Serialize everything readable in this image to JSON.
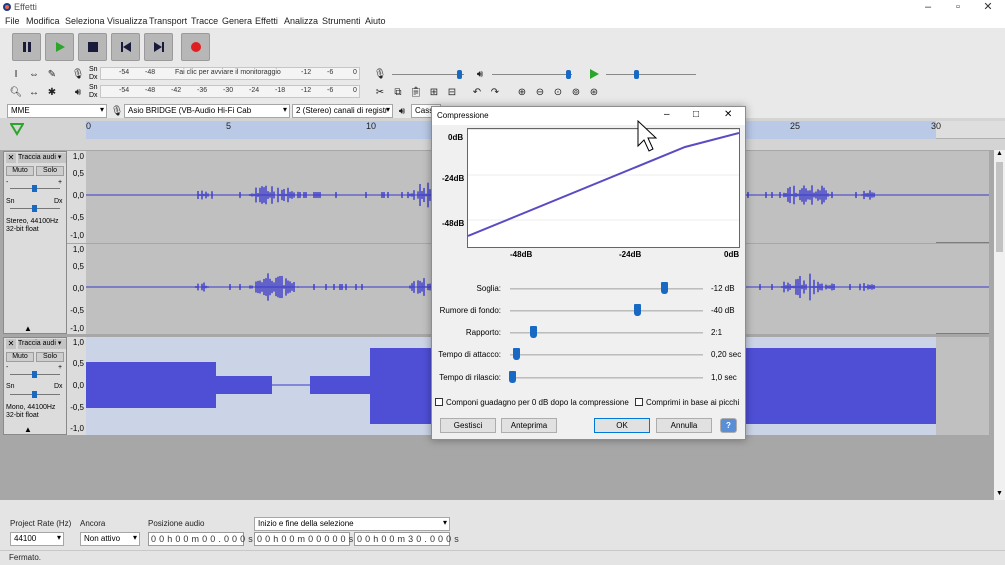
{
  "window": {
    "title": "Effetti"
  },
  "menu": [
    "File",
    "Modifica",
    "Seleziona",
    "Visualizza",
    "Transport",
    "Tracce",
    "Genera",
    "Effetti",
    "Analizza",
    "Strumenti",
    "Aiuto"
  ],
  "meters": {
    "rec_channels": [
      "Sn",
      "Dx"
    ],
    "rec_scale_a": "-54",
    "rec_scale_b": "-48",
    "rec_prompt": "Fai clic per avviare il monitoraggio",
    "rec_scale_c": "-12",
    "rec_scale_d": "-6",
    "rec_scale_e": "0",
    "play_channels": [
      "Sn",
      "Dx"
    ],
    "play_scale": [
      "-54",
      "-48",
      "-42",
      "-36",
      "-30",
      "-24",
      "-18",
      "-12",
      "-6",
      "0"
    ]
  },
  "device": {
    "host": "MME",
    "input": "Asio BRIDGE (VB-Audio Hi-Fi Cab",
    "channels": "2 (Stereo) canali di registr",
    "output": "Cass"
  },
  "ruler": {
    "ticks": [
      "0",
      "5",
      "10",
      "25",
      "30"
    ]
  },
  "tracks": [
    {
      "name": "Traccia audi",
      "mute": "Muto",
      "solo": "Solo",
      "pan_left": "Sn",
      "pan_right": "Dx",
      "gain_minus": "-",
      "gain_plus": "+",
      "info1": "Stereo, 44100Hz",
      "info2": "32-bit float",
      "scale_ch1": [
        "1,0",
        "0,5",
        "0,0",
        "-0,5",
        "-1,0"
      ],
      "scale_ch2": [
        "1,0",
        "0,5",
        "0,0",
        "-0,5",
        "-1,0"
      ]
    },
    {
      "name": "Traccia audi",
      "mute": "Muto",
      "solo": "Solo",
      "pan_left": "Sn",
      "pan_right": "Dx",
      "gain_minus": "-",
      "gain_plus": "+",
      "info1": "Mono, 44100Hz",
      "info2": "32-bit float",
      "scale_ch1": [
        "1,0",
        "0,5",
        "0,0",
        "-0,5",
        "-1,0"
      ]
    }
  ],
  "dialog": {
    "title": "Compressione",
    "graph": {
      "y_ticks": [
        "0dB",
        "-24dB",
        "-48dB"
      ],
      "x_ticks": [
        "-48dB",
        "-24dB",
        "0dB"
      ]
    },
    "params": [
      {
        "label": "Soglia:",
        "value": "-12 dB",
        "level": 0.8
      },
      {
        "label": "Rumore di fondo:",
        "value": "-40 dB",
        "level": 0.66
      },
      {
        "label": "Rapporto:",
        "value": "2:1",
        "level": 0.12
      },
      {
        "label": "Tempo di attacco:",
        "value": "0,20 sec",
        "level": 0.03
      },
      {
        "label": "Tempo di rilascio:",
        "value": "1,0 sec",
        "level": 0.01
      }
    ],
    "checkbox_makeup": "Componi guadagno per 0 dB dopo la compressione",
    "checkbox_peaks": "Comprimi in base ai picchi",
    "buttons": {
      "manage": "Gestisci",
      "preview": "Anteprima",
      "ok": "OK",
      "cancel": "Annulla",
      "help": "?"
    }
  },
  "bottom": {
    "rate_label": "Project Rate (Hz)",
    "rate_value": "44100",
    "snap_label": "Ancora",
    "snap_value": "Non attivo",
    "pos_label": "Posizione audio",
    "pos_value": "0 0 h 0 0 m 0 0 . 0 0 0 s",
    "sel_label": "Inizio e fine della selezione",
    "sel_start": "0 0 h 0 0 m 0 0 0 0 0 s",
    "sel_end": "0 0 h 0 0 m 3 0 . 0 0 0 s",
    "status": "Fermato."
  },
  "colors": {
    "waveform": "#3a3acc",
    "record": "#e02020",
    "play": "#2da52d",
    "slider": "#1769c4"
  }
}
